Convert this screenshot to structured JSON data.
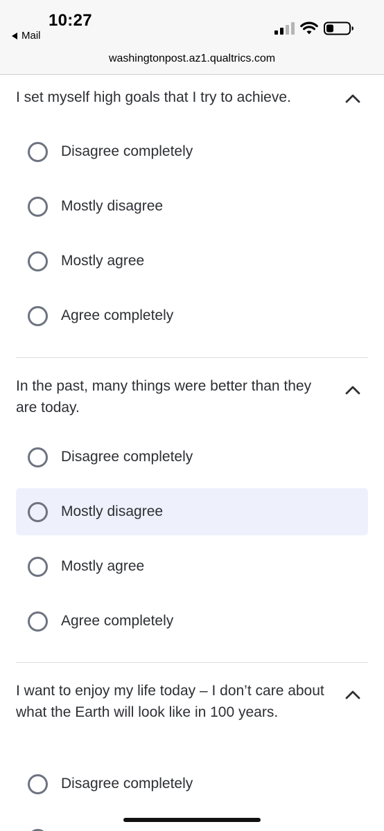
{
  "status_bar": {
    "time": "10:27",
    "back_label": "Mail",
    "url": "washingtonpost.az1.qualtrics.com",
    "icons": [
      "cellular-signal-icon",
      "wifi-icon",
      "battery-icon"
    ]
  },
  "questions": [
    {
      "text": "I set myself high goals that I try to achieve.",
      "options": [
        "Disagree completely",
        "Mostly disagree",
        "Mostly agree",
        "Agree completely"
      ]
    },
    {
      "text": "In the past, many things were better than they are today.",
      "options": [
        "Disagree completely",
        "Mostly disagree",
        "Mostly agree",
        "Agree completely"
      ],
      "highlighted_option": "Mostly disagree"
    },
    {
      "text": "I want to enjoy my life today – I don’t care about what the Earth will look like in 100 years.",
      "options": [
        "Disagree completely"
      ]
    }
  ],
  "colors": {
    "text": "#2d2f33",
    "radio_border": "#6e7380",
    "highlight_bg": "#eef0fb",
    "divider": "#dcdcdc",
    "status_bar_bg": "#f7f7f7"
  }
}
